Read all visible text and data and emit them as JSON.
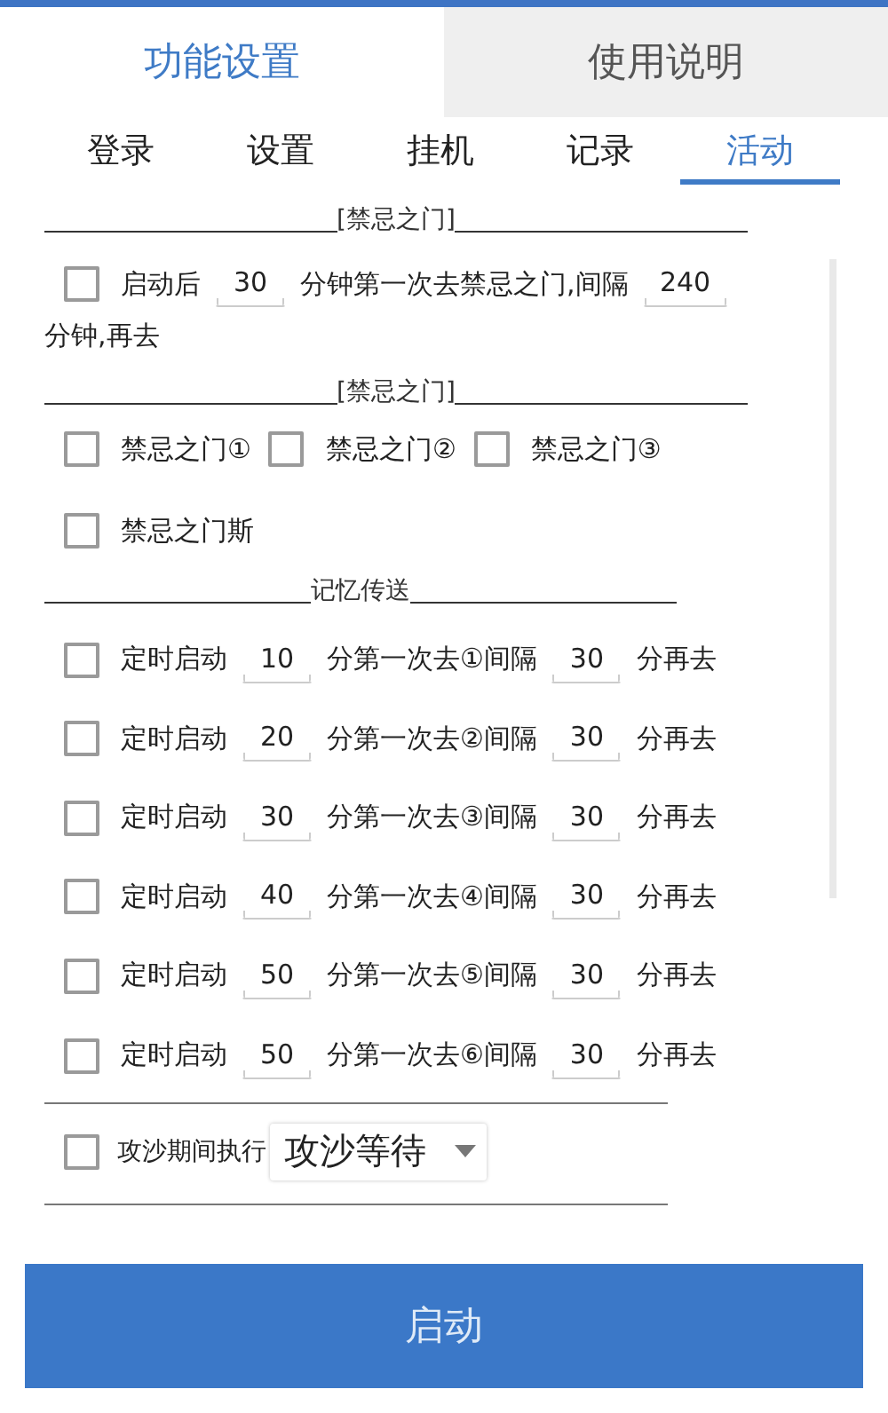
{
  "main_tabs": [
    {
      "label": "功能设置",
      "selected": true
    },
    {
      "label": "使用说明",
      "selected": false
    }
  ],
  "sub_tabs": [
    {
      "label": "登录",
      "selected": false
    },
    {
      "label": "设置",
      "selected": false
    },
    {
      "label": "挂机",
      "selected": false
    },
    {
      "label": "记录",
      "selected": false
    },
    {
      "label": "活动",
      "selected": true
    }
  ],
  "gate_timer": {
    "title": "[禁忌之门]",
    "checked": false,
    "prefix": "启动后",
    "first": "30",
    "middle": "分钟第一次去禁忌之门,间隔",
    "interval": "240",
    "suffix": "分钟,再去"
  },
  "gates": {
    "title": "[禁忌之门]",
    "options": [
      {
        "label": "禁忌之门①",
        "checked": false
      },
      {
        "label": "禁忌之门②",
        "checked": false
      },
      {
        "label": "禁忌之门③",
        "checked": false
      },
      {
        "label": "禁忌之门斯",
        "checked": false
      }
    ]
  },
  "memory_teleport": {
    "title": "记忆传送",
    "rows": [
      {
        "checked": false,
        "label": "定时启动",
        "first": "10",
        "middle": "分第一次去①间隔",
        "interval": "30",
        "suffix": "分再去"
      },
      {
        "checked": false,
        "label": "定时启动",
        "first": "20",
        "middle": "分第一次去②间隔",
        "interval": "30",
        "suffix": "分再去"
      },
      {
        "checked": false,
        "label": "定时启动",
        "first": "30",
        "middle": "分第一次去③间隔",
        "interval": "30",
        "suffix": "分再去"
      },
      {
        "checked": false,
        "label": "定时启动",
        "first": "40",
        "middle": "分第一次去④间隔",
        "interval": "30",
        "suffix": "分再去"
      },
      {
        "checked": false,
        "label": "定时启动",
        "first": "50",
        "middle": "分第一次去⑤间隔",
        "interval": "30",
        "suffix": "分再去"
      },
      {
        "checked": false,
        "label": "定时启动",
        "first": "50",
        "middle": "分第一次去⑥间隔",
        "interval": "30",
        "suffix": "分再去"
      }
    ]
  },
  "siege": {
    "checked": false,
    "label": "攻沙期间执行",
    "selection": "攻沙等待"
  },
  "start_button": "启动"
}
